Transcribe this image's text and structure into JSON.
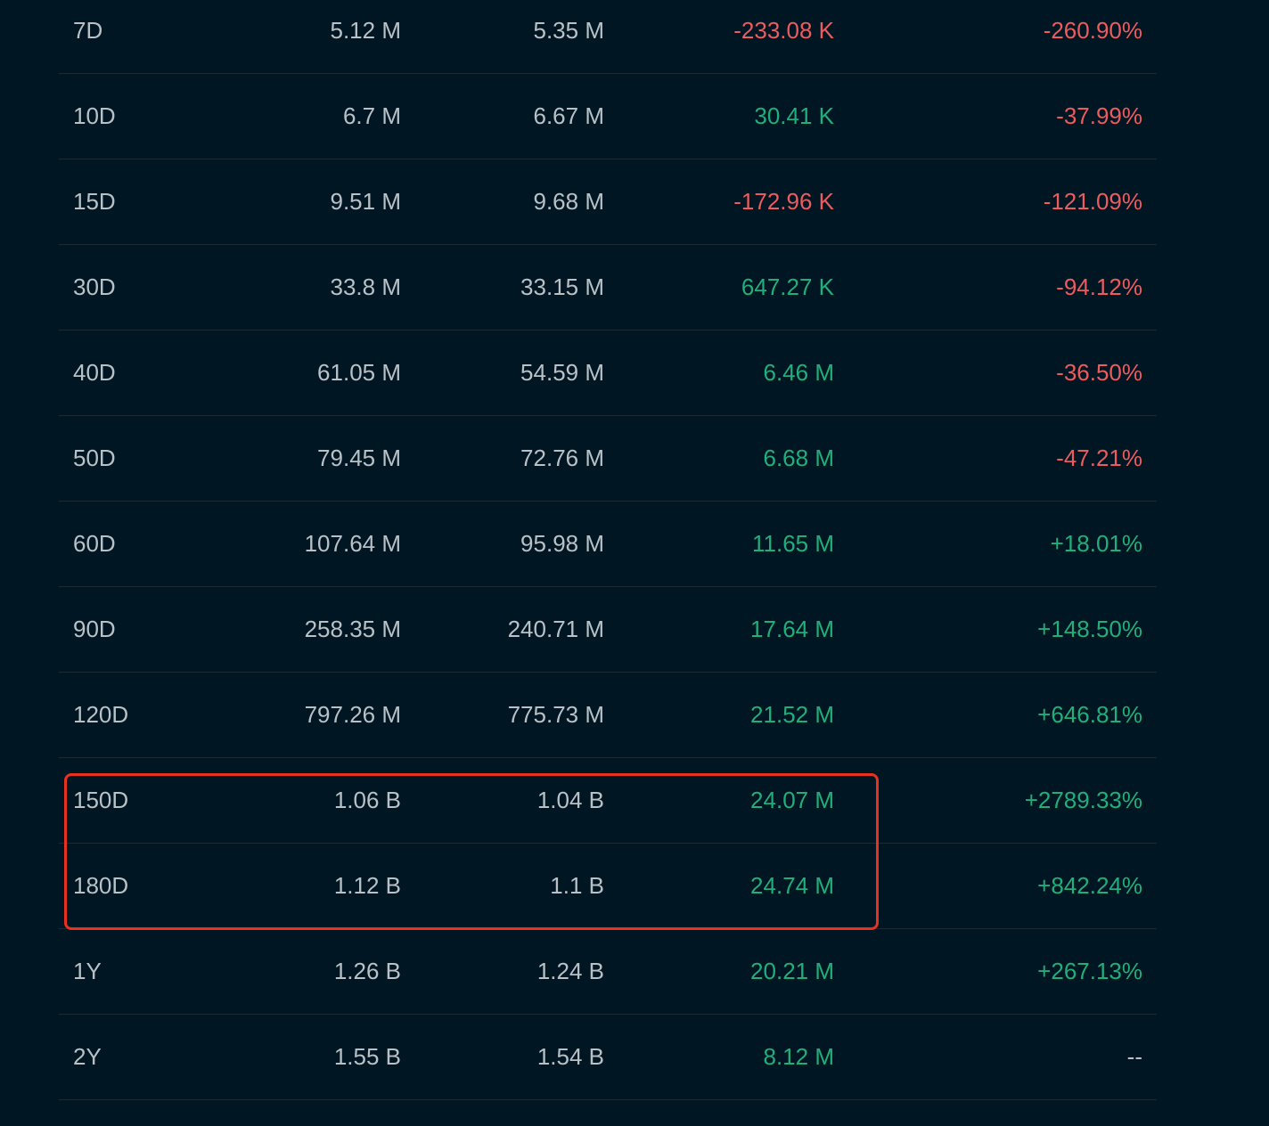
{
  "colors": {
    "background": "#001622",
    "text": "#b9c1c6",
    "negative": "#ec5b5e",
    "positive": "#22ae7a",
    "highlight": "#e8311f"
  },
  "rows": [
    {
      "period": "7D",
      "col1": "5.12 M",
      "col2": "5.35 M",
      "col3": "-233.08 K",
      "col3_sign": "neg",
      "col4": "-260.90%",
      "col4_sign": "neg"
    },
    {
      "period": "10D",
      "col1": "6.7 M",
      "col2": "6.67 M",
      "col3": "30.41 K",
      "col3_sign": "pos",
      "col4": "-37.99%",
      "col4_sign": "neg"
    },
    {
      "period": "15D",
      "col1": "9.51 M",
      "col2": "9.68 M",
      "col3": "-172.96 K",
      "col3_sign": "neg",
      "col4": "-121.09%",
      "col4_sign": "neg"
    },
    {
      "period": "30D",
      "col1": "33.8 M",
      "col2": "33.15 M",
      "col3": "647.27 K",
      "col3_sign": "pos",
      "col4": "-94.12%",
      "col4_sign": "neg"
    },
    {
      "period": "40D",
      "col1": "61.05 M",
      "col2": "54.59 M",
      "col3": "6.46 M",
      "col3_sign": "pos",
      "col4": "-36.50%",
      "col4_sign": "neg"
    },
    {
      "period": "50D",
      "col1": "79.45 M",
      "col2": "72.76 M",
      "col3": "6.68 M",
      "col3_sign": "pos",
      "col4": "-47.21%",
      "col4_sign": "neg"
    },
    {
      "period": "60D",
      "col1": "107.64 M",
      "col2": "95.98 M",
      "col3": "11.65 M",
      "col3_sign": "pos",
      "col4": "+18.01%",
      "col4_sign": "pos"
    },
    {
      "period": "90D",
      "col1": "258.35 M",
      "col2": "240.71 M",
      "col3": "17.64 M",
      "col3_sign": "pos",
      "col4": "+148.50%",
      "col4_sign": "pos"
    },
    {
      "period": "120D",
      "col1": "797.26 M",
      "col2": "775.73 M",
      "col3": "21.52 M",
      "col3_sign": "pos",
      "col4": "+646.81%",
      "col4_sign": "pos"
    },
    {
      "period": "150D",
      "col1": "1.06 B",
      "col2": "1.04 B",
      "col3": "24.07 M",
      "col3_sign": "pos",
      "col4": "+2789.33%",
      "col4_sign": "pos"
    },
    {
      "period": "180D",
      "col1": "1.12 B",
      "col2": "1.1 B",
      "col3": "24.74 M",
      "col3_sign": "pos",
      "col4": "+842.24%",
      "col4_sign": "pos"
    },
    {
      "period": "1Y",
      "col1": "1.26 B",
      "col2": "1.24 B",
      "col3": "20.21 M",
      "col3_sign": "pos",
      "col4": "+267.13%",
      "col4_sign": "pos"
    },
    {
      "period": "2Y",
      "col1": "1.55 B",
      "col2": "1.54 B",
      "col3": "8.12 M",
      "col3_sign": "pos",
      "col4": "--",
      "col4_sign": "neutral"
    }
  ]
}
